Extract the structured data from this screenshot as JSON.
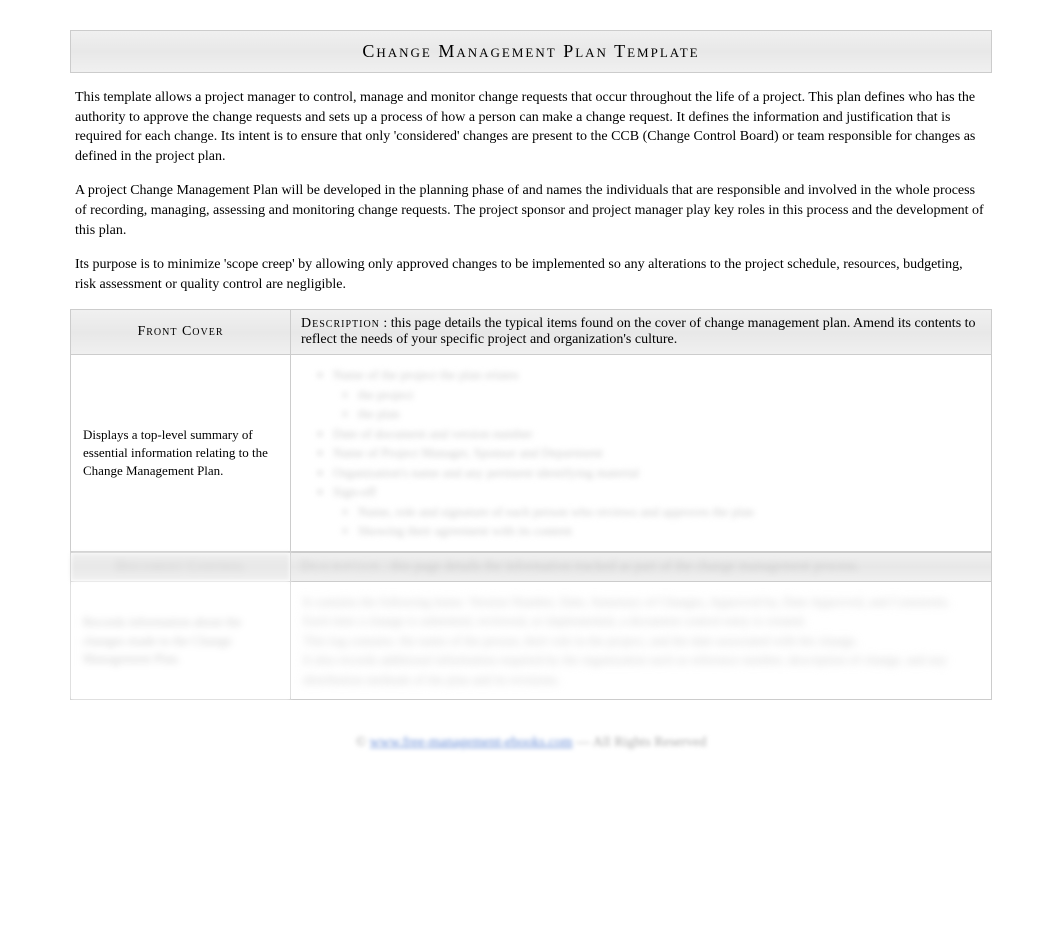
{
  "title": "Change Management Plan Template",
  "intro": {
    "p1": "This template allows a project manager to control, manage and monitor change requests that occur throughout the life of a project. This plan defines who has the authority to approve the change requests and sets up a process of how a person can make a change request. It defines the information and justification that is required for each change. Its intent is to ensure that only 'considered' changes are present to the CCB (Change Control Board) or team responsible for changes as defined in the project plan.",
    "p2": "A project Change Management Plan will be developed in the planning phase of and names the individuals that are responsible and involved in the whole process of recording, managing, assessing and monitoring change requests. The project sponsor and project manager play key roles in this process and the development of this plan.",
    "p3": "Its purpose is to minimize 'scope creep' by allowing only approved changes to be implemented so any alterations to the project schedule, resources, budgeting, risk assessment or quality control are negligible."
  },
  "sections": [
    {
      "name": "Front Cover",
      "description_label": "Description",
      "description": " : this page details the typical items found on the cover of change management plan. Amend its contents to reflect the needs of your specific project and organization's culture.",
      "body_left": "Displays a top-level summary of essential information relating to the Change Management Plan.",
      "body_right_placeholder": "blurred-list"
    },
    {
      "name": "Document Control",
      "description_label": "Description",
      "description": " : this page details the information tracked as part of the change management process.",
      "body_left": "Records information about the changes made to the Change Management Plan.",
      "body_right_placeholder": "blurred-para"
    }
  ],
  "footer": {
    "copyright": "© ",
    "link_text": "www.free-management-ebooks.com",
    "rights": " — All Rights Reserved"
  }
}
